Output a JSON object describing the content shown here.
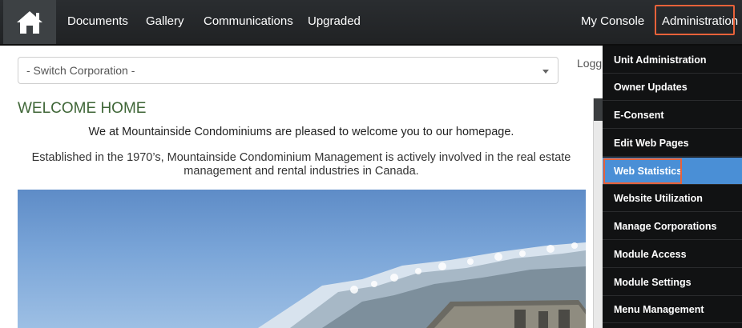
{
  "navbar": {
    "home_icon": "home-icon",
    "links": [
      "Documents",
      "Gallery",
      "Communications",
      "Upgraded"
    ],
    "my_console": "My Console",
    "administration": "Administration"
  },
  "main": {
    "switch_corporation": "- Switch Corporation -",
    "welcome_title": "WELCOME HOME",
    "intro": "We at Mountainside Condominiums are pleased to welcome you to our homepage.",
    "description_line1": "Established in the 1970’s, Mountainside Condominium Management is actively involved in the real estate",
    "description_line2": "management and rental industries in Canada."
  },
  "side": {
    "logged_text": "Logg"
  },
  "admin_menu": {
    "items": [
      "Unit Administration",
      "Owner Updates",
      "E-Consent",
      "Edit Web Pages",
      "Web Statistics",
      "Website Utilization",
      "Manage Corporations",
      "Module Access",
      "Module Settings",
      "Menu Management"
    ],
    "active_item": "Web Statistics"
  },
  "colors": {
    "navbar_bg": "#232527",
    "highlight_border": "#e8623a",
    "active_item_bg": "#4a8fd6",
    "welcome_title": "#3f6637"
  }
}
